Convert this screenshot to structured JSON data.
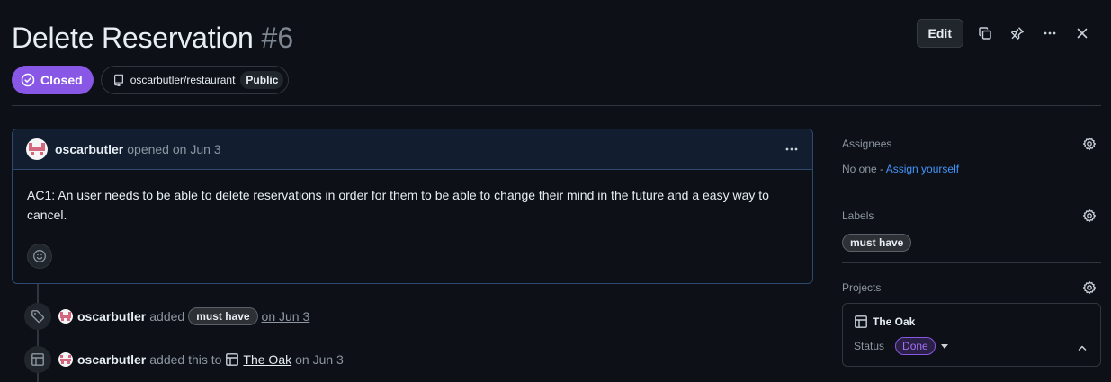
{
  "header": {
    "title": "Delete Reservation",
    "number": "#6",
    "edit_label": "Edit"
  },
  "meta": {
    "state": "Closed",
    "repo": "oscarbutler/restaurant",
    "visibility": "Public"
  },
  "comment": {
    "author": "oscarbutler",
    "opened": "opened on Jun 3",
    "body": "AC1: An user needs to be able to delete reservations in order for them to be able to change their mind in the future and a easy way to cancel."
  },
  "timeline": [
    {
      "author": "oscarbutler",
      "action": "added",
      "label": "must have",
      "date": "on Jun 3"
    },
    {
      "author": "oscarbutler",
      "action": "added this to",
      "project": "The Oak",
      "date": "on Jun 3"
    }
  ],
  "sidebar": {
    "assignees": {
      "title": "Assignees",
      "value": "No one - ",
      "link": "Assign yourself"
    },
    "labels": {
      "title": "Labels",
      "items": [
        "must have"
      ]
    },
    "projects": {
      "title": "Projects",
      "name": "The Oak",
      "status_label": "Status",
      "status_value": "Done"
    }
  },
  "colors": {
    "background": "#0d1117",
    "closed_badge": "#8957e5",
    "link": "#4493f8",
    "done": "#a371f7"
  },
  "icons": [
    "copy-icon",
    "pin-icon",
    "kebab-horizontal-icon",
    "close-icon",
    "issue-closed-icon",
    "repo-icon",
    "smiley-icon",
    "tag-icon",
    "table-icon",
    "gear-icon",
    "chevron-up-icon"
  ]
}
